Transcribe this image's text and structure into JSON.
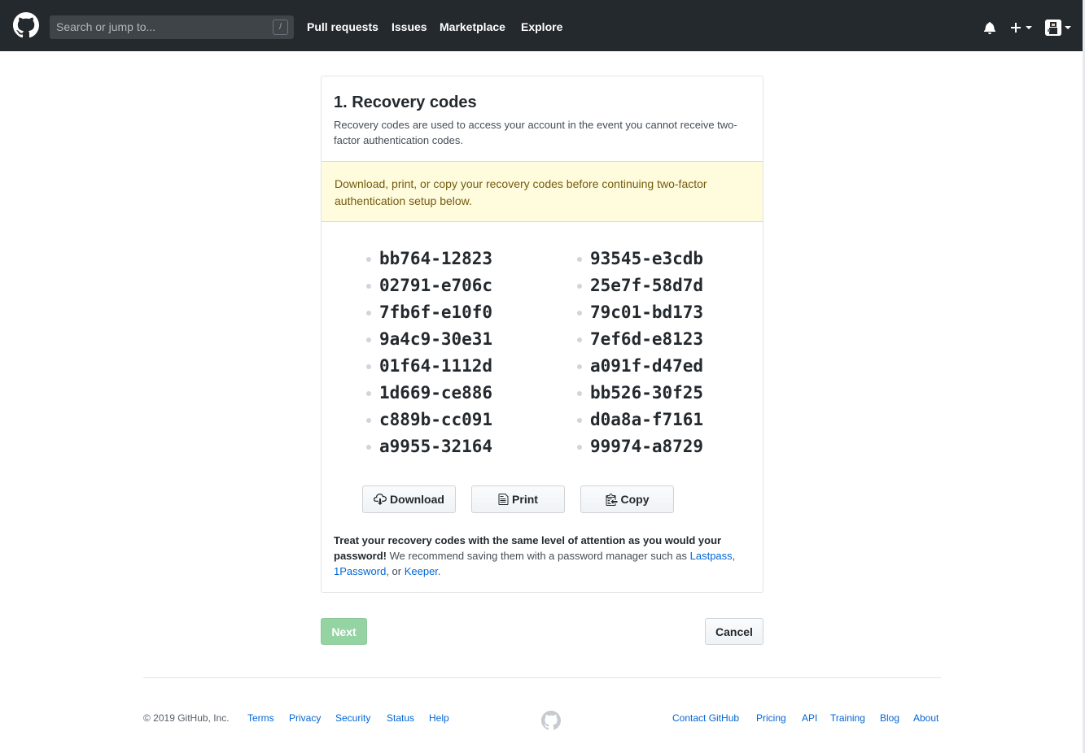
{
  "header": {
    "search_placeholder": "Search or jump to...",
    "search_shortcut": "/",
    "nav": [
      "Pull requests",
      "Issues",
      "Marketplace",
      "Explore"
    ]
  },
  "recovery": {
    "title": "1. Recovery codes",
    "description": "Recovery codes are used to access your account in the event you cannot receive two-factor authentication codes.",
    "flash": "Download, print, or copy your recovery codes before continuing two-factor authentication setup below.",
    "codes_left": [
      "bb764-12823",
      "02791-e706c",
      "7fb6f-e10f0",
      "9a4c9-30e31",
      "01f64-1112d",
      "1d669-ce886",
      "c889b-cc091",
      "a9955-32164"
    ],
    "codes_right": [
      "93545-e3cdb",
      "25e7f-58d7d",
      "79c01-bd173",
      "7ef6d-e8123",
      "a091f-d47ed",
      "bb526-30f25",
      "d0a8a-f7161",
      "99974-a8729"
    ],
    "buttons": {
      "download": "Download",
      "print": "Print",
      "copy": "Copy"
    },
    "note_bold": "Treat your recovery codes with the same level of attention as you would your password!",
    "note_text": " We recommend saving them with a password manager such as ",
    "links": [
      "Lastpass",
      "1Password",
      "Keeper"
    ],
    "sep1": ", ",
    "sep2": ", or ",
    "end": "."
  },
  "actions": {
    "next": "Next",
    "cancel": "Cancel"
  },
  "footer": {
    "copyright": "© 2019 GitHub, Inc.",
    "left_links": [
      "Terms",
      "Privacy",
      "Security",
      "Status",
      "Help"
    ],
    "right_links": [
      "Contact GitHub",
      "Pricing",
      "API",
      "Training",
      "Blog",
      "About"
    ]
  },
  "colors": {
    "header_bg": "#24292e",
    "link": "#0366d6",
    "flash_bg": "#fffbdd",
    "next_disabled": "#94d3a2"
  },
  "icons": [
    "github-logo-icon",
    "bell-icon",
    "plus-icon",
    "download-icon",
    "print-icon",
    "copy-icon"
  ]
}
